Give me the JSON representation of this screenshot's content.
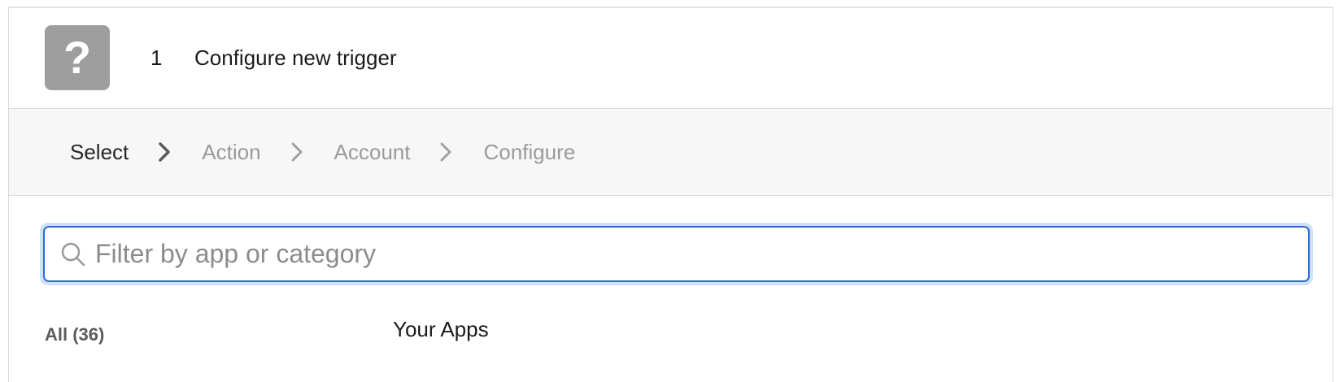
{
  "header": {
    "icon_glyph": "?",
    "icon_name": "question-mark-icon",
    "step_number": "1",
    "step_title": "Configure new trigger"
  },
  "stepper": {
    "steps": [
      {
        "label": "Select",
        "active": true
      },
      {
        "label": "Action",
        "active": false
      },
      {
        "label": "Account",
        "active": false
      },
      {
        "label": "Configure",
        "active": false
      }
    ]
  },
  "search": {
    "value": "",
    "placeholder": "Filter by app or category"
  },
  "filters": {
    "all_label": "All (36)"
  },
  "main": {
    "section_heading": "Your Apps"
  },
  "colors": {
    "accent": "#2f6bd1",
    "focus_ring": "#cfe0f7",
    "icon_bg": "#9e9e9e",
    "stepper_bg": "#f7f7f7"
  }
}
